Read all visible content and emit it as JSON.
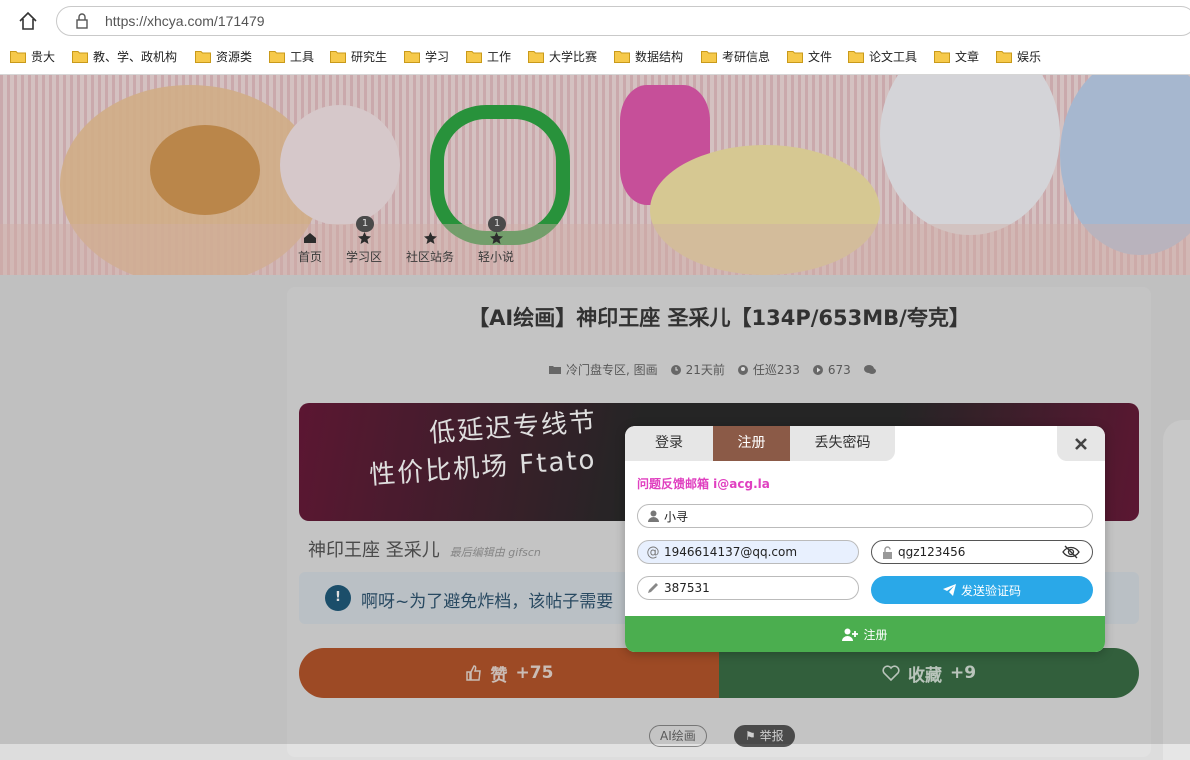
{
  "browser": {
    "url": "https://xhcya.com/171479",
    "bookmarks": [
      "贵大",
      "教、学、政机构",
      "资源类",
      "工具",
      "研究生",
      "学习",
      "工作",
      "大学比赛",
      "数据结构",
      "考研信息",
      "文件",
      "论文工具",
      "文章",
      "娱乐"
    ]
  },
  "nav": {
    "items": [
      {
        "label": "首页",
        "icon": "home-icon",
        "badge": ""
      },
      {
        "label": "学习区",
        "icon": "star-icon",
        "badge": "1"
      },
      {
        "label": "社区站务",
        "icon": "star-icon",
        "badge": ""
      },
      {
        "label": "轻小说",
        "icon": "star-icon",
        "badge": "1"
      }
    ]
  },
  "post": {
    "title": "【AI绘画】神印王座 圣采儿【134P/653MB/夸克】",
    "category": "冷门盘专区, 图画",
    "time": "21天前",
    "author": "任巡233",
    "views": "673",
    "ad_line1": "低延迟专线节",
    "ad_line2": "性价比机场 Ftato",
    "subtitle": "神印王座 圣采儿",
    "edited": "最后编辑由 gifscn",
    "notice": "啊呀~为了避免炸档，该帖子需要",
    "like_label": "赞",
    "like_count": "+75",
    "fav_label": "收藏",
    "fav_count": "+9",
    "tag": "AI绘画",
    "report": "举报"
  },
  "modal": {
    "tabs": [
      "登录",
      "注册",
      "丢失密码"
    ],
    "active_tab": "注册",
    "feedback": "问题反馈邮箱 i@acg.la",
    "username": "小寻",
    "email": "1946614137@qq.com",
    "password": "qgz123456",
    "code": "387531",
    "send_label": "发送验证码",
    "register_label": "注册"
  },
  "colors": {
    "register_green": "#4bae4f",
    "send_blue": "#2aa8e8",
    "tab_active": "#8b5a47",
    "feedback_pink": "#e040c0"
  }
}
